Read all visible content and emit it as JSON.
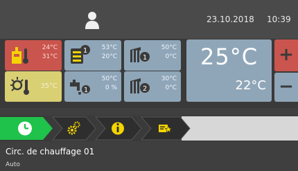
{
  "header": {
    "date": "23.10.2018",
    "time": "10:39",
    "user_icon": "user-icon"
  },
  "tiles": [
    {
      "id": "boiler",
      "icon": "boiler-thermometer-icon",
      "color": "#c9554e",
      "values": [
        "24°C",
        "31°C"
      ]
    },
    {
      "id": "tank-1",
      "icon": "tank-1-icon",
      "color": "#8fa6b8",
      "values": [
        "53°C",
        "20°C"
      ]
    },
    {
      "id": "circuit-1",
      "icon": "heating-circuit-1-icon",
      "color": "#8fa6b8",
      "values": [
        "50°C",
        "0°C"
      ]
    },
    {
      "id": "solar",
      "icon": "solar-thermometer-icon",
      "color": "#d9cf73",
      "values": [
        "35°C"
      ]
    },
    {
      "id": "dhw",
      "icon": "hot-water-tap-icon",
      "color": "#8fa6b8",
      "values": [
        "50°C",
        "0 %"
      ]
    },
    {
      "id": "circuit-2",
      "icon": "heating-circuit-2-icon",
      "color": "#8fa6b8",
      "values": [
        "30°C",
        "0°C"
      ]
    }
  ],
  "temperature": {
    "setpoint": "25°C",
    "current": "22°C",
    "plus_label": "+",
    "minus_label": "−"
  },
  "tabs": [
    {
      "icon": "clock-icon",
      "active": true
    },
    {
      "icon": "gears-icon",
      "active": false
    },
    {
      "icon": "info-icon",
      "active": false
    },
    {
      "icon": "favorite-star-icon",
      "active": false
    }
  ],
  "circuit": {
    "name": "Circ. de chauffage 01",
    "mode": "Auto"
  },
  "colors": {
    "background": "#3f3f3f",
    "tile_blue": "#8fa6b8",
    "tile_red": "#c9554e",
    "tile_yellow": "#d9cf73",
    "active_tab": "#1fc24a",
    "icon_yellow": "#f3d400"
  }
}
